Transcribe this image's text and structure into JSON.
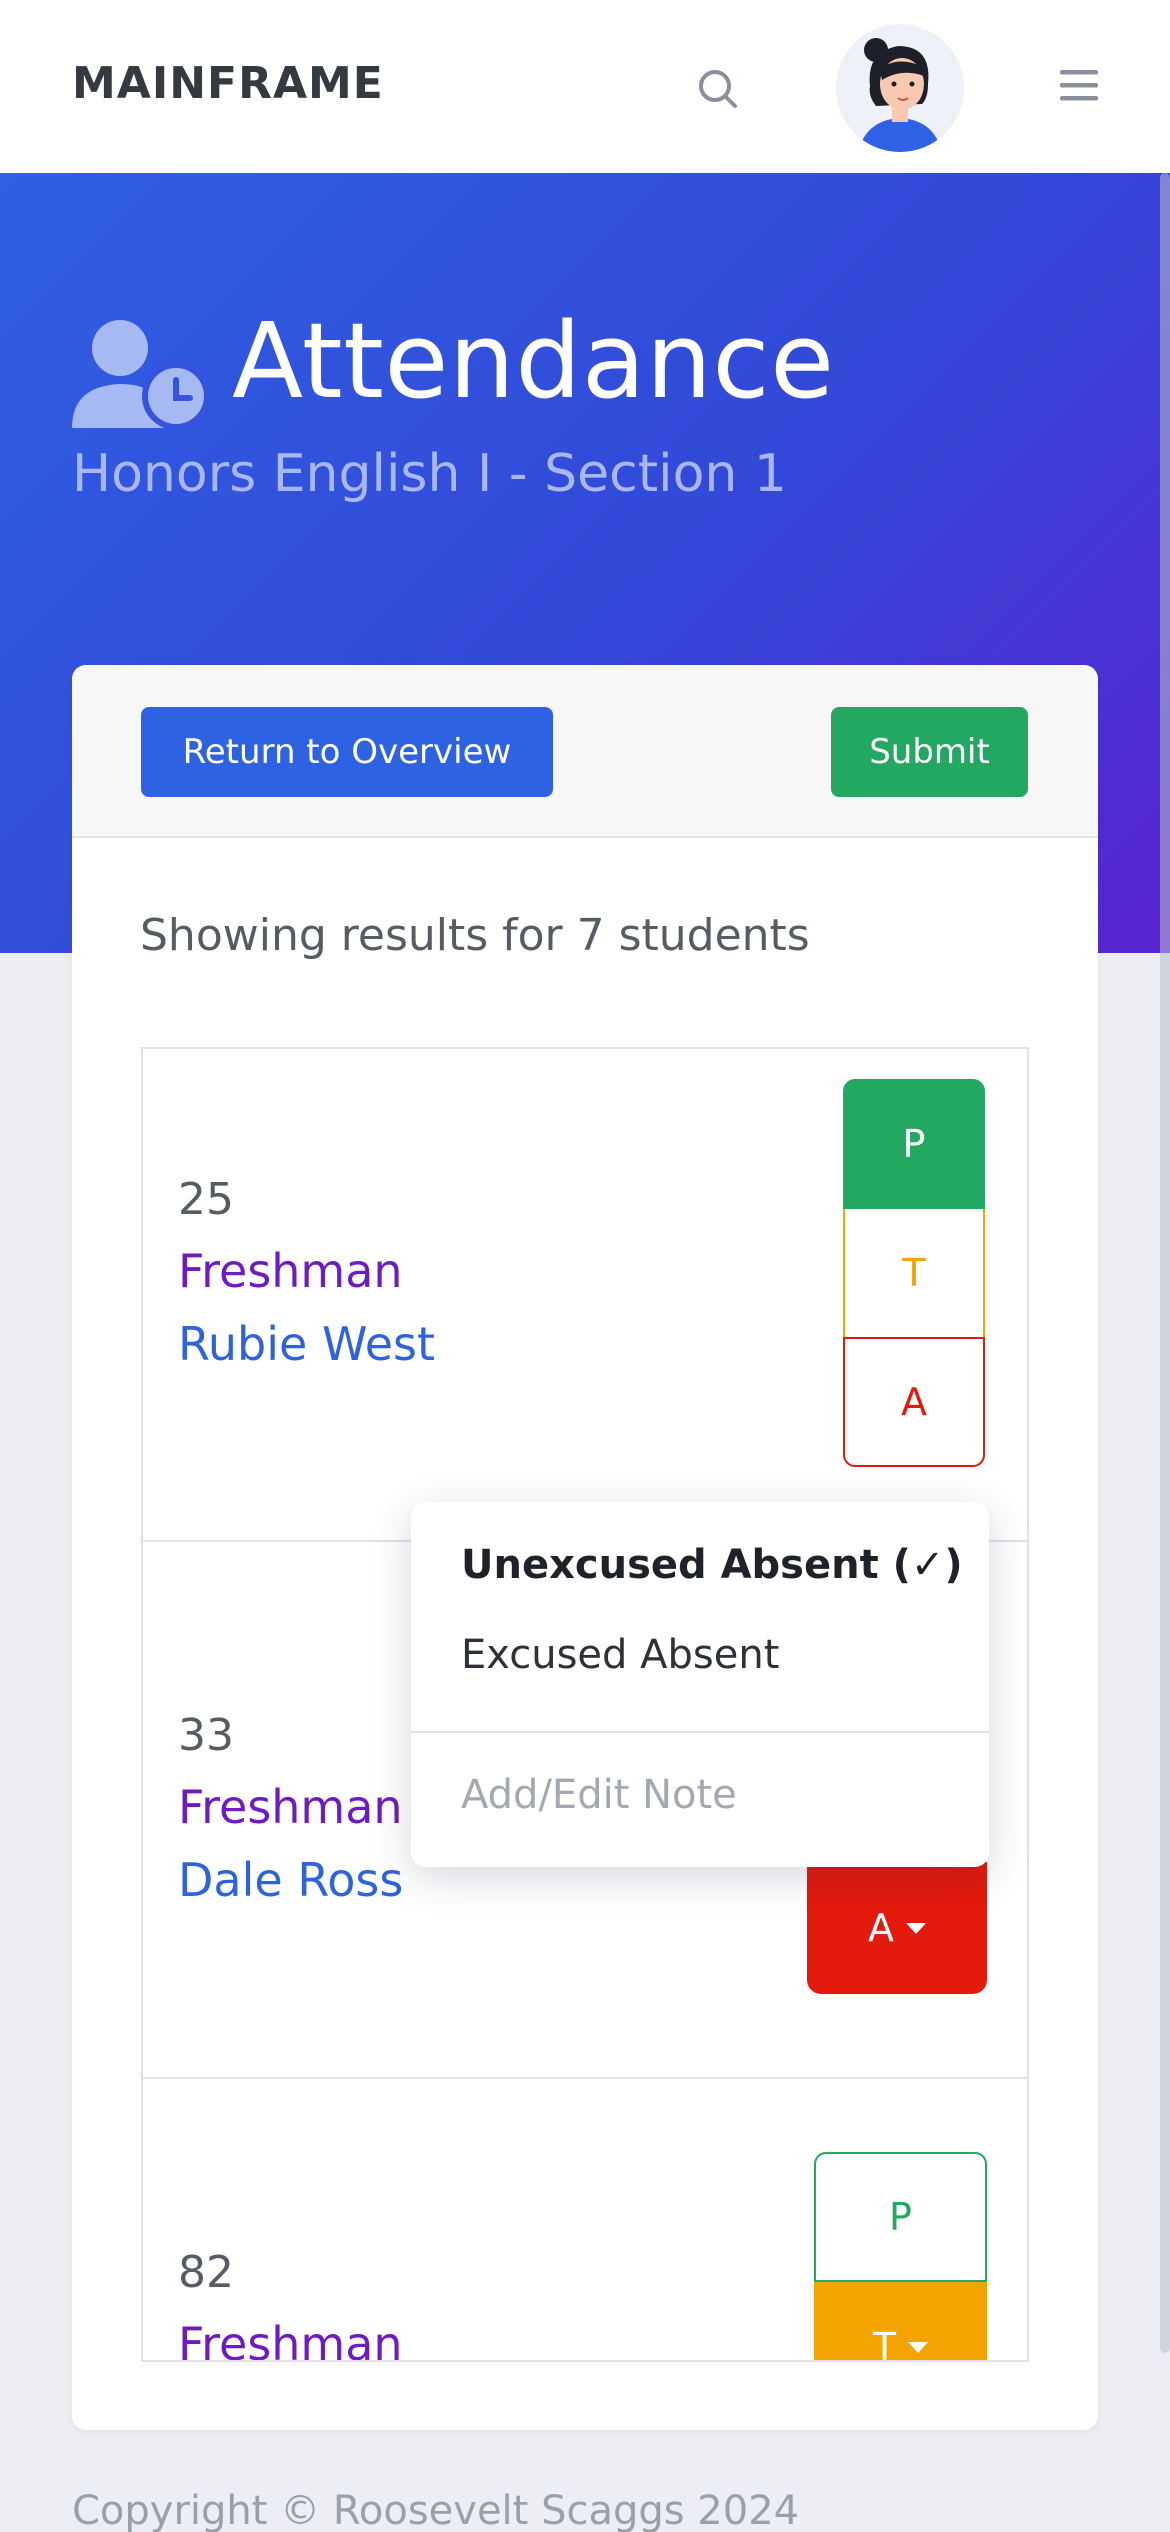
{
  "nav": {
    "brand": "MAINFRAME",
    "icons": [
      "search-icon",
      "user-avatar",
      "hamburger-menu-icon"
    ]
  },
  "hero": {
    "title": "Attendance",
    "subtitle": "Honors English I - Section 1",
    "icon": "user-clock-icon"
  },
  "toolbar": {
    "return_label": "Return to Overview",
    "submit_label": "Submit"
  },
  "results_text": "Showing results for 7 students",
  "students": [
    {
      "number": "25",
      "grade": "Freshman",
      "name": "Rubie West",
      "status_buttons": {
        "present": "P",
        "tardy": "T",
        "absent": "A"
      },
      "selected": "P"
    },
    {
      "number": "33",
      "grade": "Freshman",
      "name": "Dale Ross",
      "status_buttons": {
        "absent": "A"
      },
      "selected": "A"
    },
    {
      "number": "82",
      "grade": "Freshman",
      "status_buttons": {
        "present": "P",
        "tardy": "T"
      },
      "selected": "T"
    }
  ],
  "dropdown": {
    "unexcused": "Unexcused Absent (✓)",
    "excused": "Excused Absent",
    "note": "Add/Edit Note"
  },
  "footer": "Copyright © Roosevelt Scaggs 2024",
  "colors": {
    "present": "#22a861",
    "tardy": "#f5a300",
    "absent": "#e31a0c",
    "primary": "#2d62e3",
    "grade": "#6f1bc2"
  }
}
